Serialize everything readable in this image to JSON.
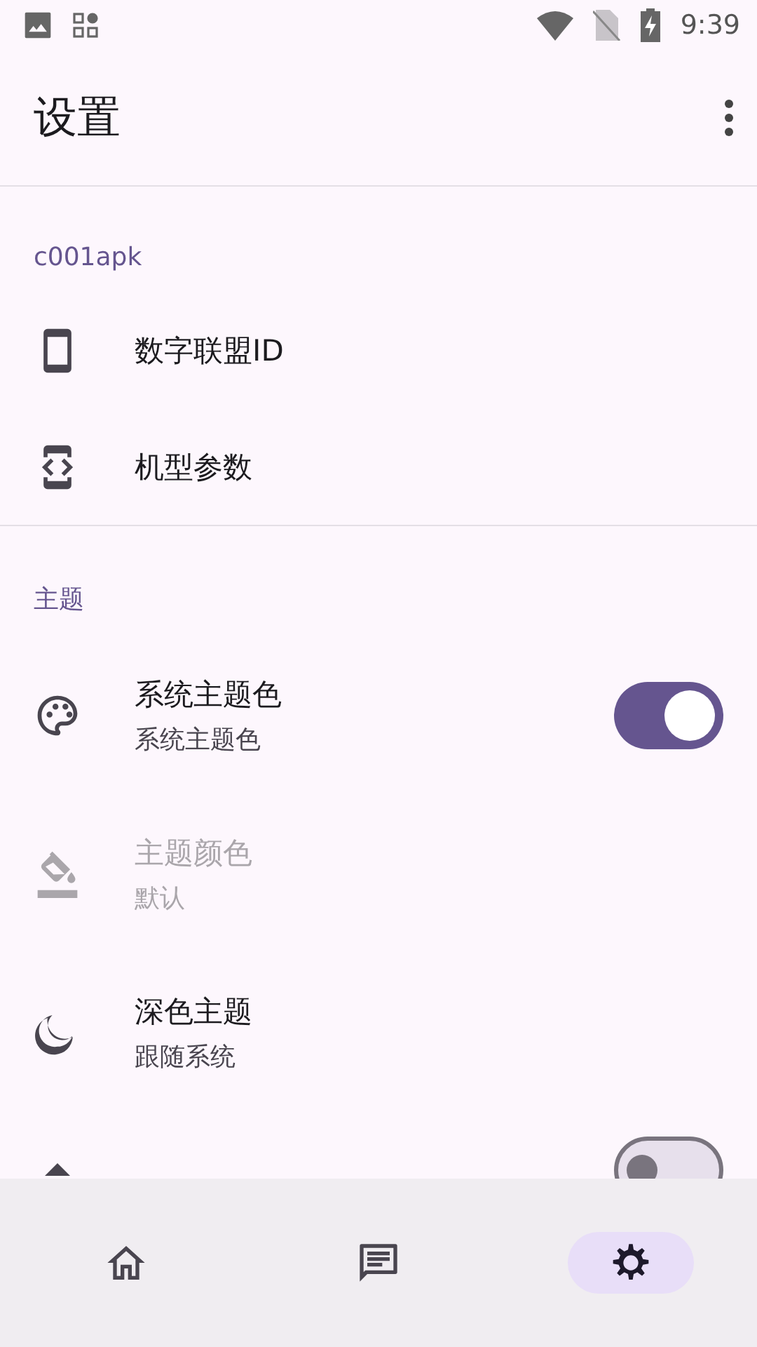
{
  "status_bar": {
    "time": "9:39"
  },
  "toolbar": {
    "title": "设置"
  },
  "sections": [
    {
      "header": "c001apk",
      "items": [
        {
          "kind": "link",
          "title": "数字联盟ID",
          "disabled": false
        },
        {
          "kind": "link",
          "title": "机型参数",
          "disabled": false
        }
      ]
    },
    {
      "header": "主题",
      "items": [
        {
          "kind": "switch",
          "title": "系统主题色",
          "subtitle": "系统主题色",
          "checked": true,
          "disabled": false
        },
        {
          "kind": "link",
          "title": "主题颜色",
          "subtitle": "默认",
          "disabled": true
        },
        {
          "kind": "link",
          "title": "深色主题",
          "subtitle": "跟随系统",
          "disabled": false
        },
        {
          "kind": "switch",
          "checked": false,
          "disabled": false
        }
      ]
    }
  ],
  "bottom_nav": [
    {
      "selected": false
    },
    {
      "selected": false
    },
    {
      "selected": true
    }
  ]
}
